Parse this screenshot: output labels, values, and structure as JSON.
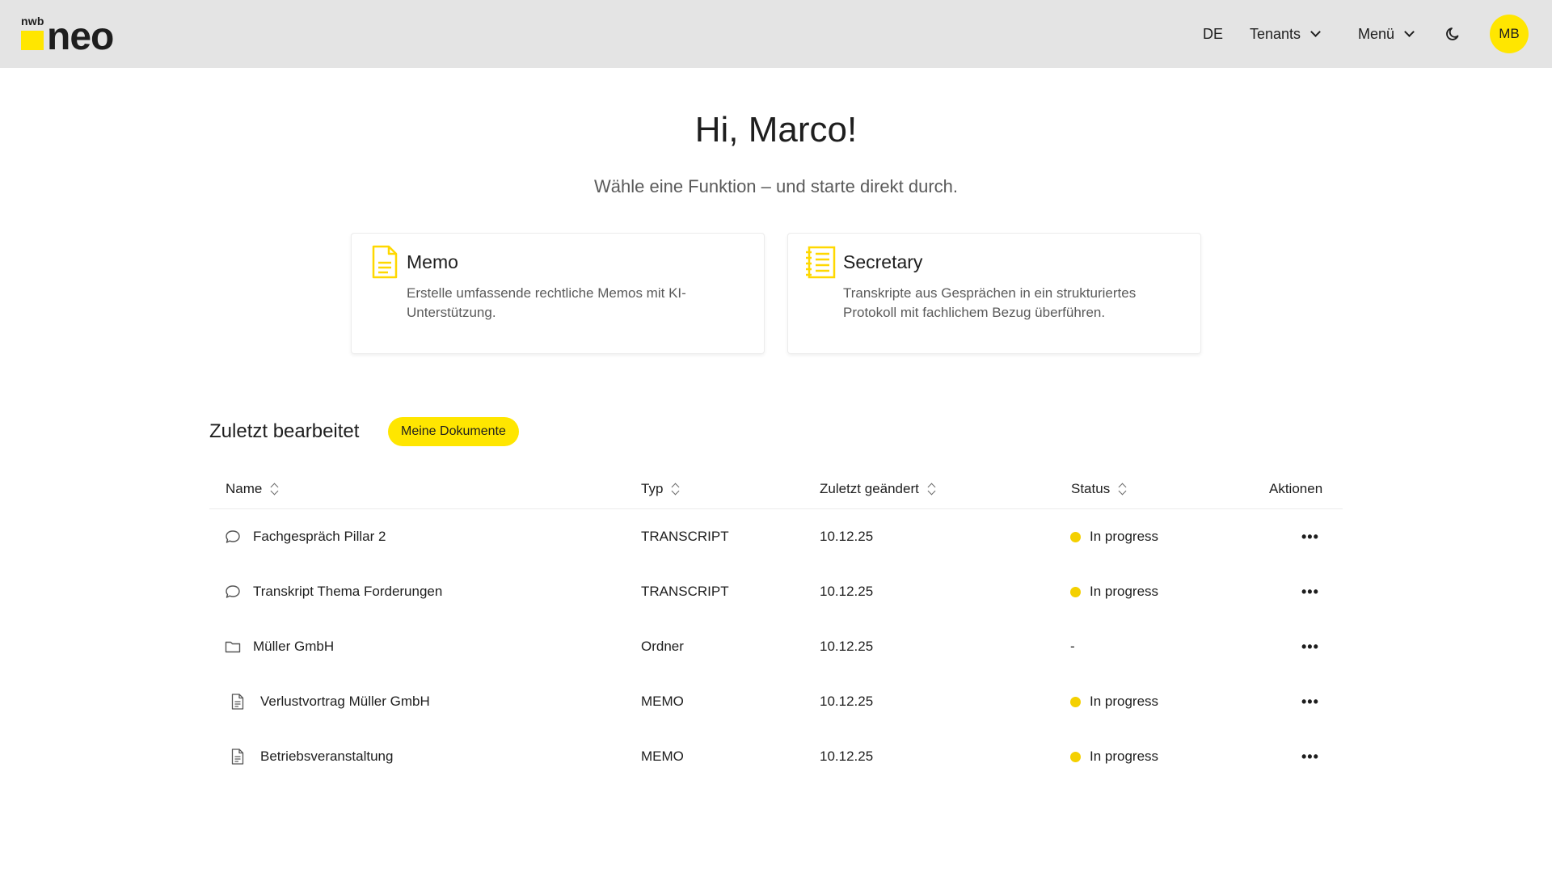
{
  "header": {
    "logo_small": "nwb",
    "logo_main": "neo",
    "language": "DE",
    "tenants_label": "Tenants",
    "menu_label": "Menü",
    "avatar_initials": "MB",
    "accent_color": "#ffe600"
  },
  "welcome": {
    "greeting": "Hi, Marco!",
    "subtitle": "Wähle eine Funktion – und starte direkt durch."
  },
  "cards": [
    {
      "title": "Memo",
      "description": "Erstelle umfassende rechtliche Memos mit KI-Unterstützung.",
      "icon": "document-icon"
    },
    {
      "title": "Secretary",
      "description": "Transkripte aus Gesprächen in ein strukturiertes Protokoll mit fachlichem Bezug überführen.",
      "icon": "notepad-icon"
    }
  ],
  "recent": {
    "title": "Zuletzt bearbeitet",
    "my_documents_label": "Meine Dokumente",
    "columns": {
      "name": "Name",
      "type": "Typ",
      "modified": "Zuletzt geändert",
      "status": "Status",
      "actions": "Aktionen"
    },
    "rows": [
      {
        "icon": "chat-icon",
        "name": "Fachgespräch Pillar 2",
        "type": "TRANSCRIPT",
        "modified": "10.12.25",
        "status": "In progress",
        "actions": "•••"
      },
      {
        "icon": "chat-icon",
        "name": "Transkript Thema Forderungen",
        "type": "TRANSCRIPT",
        "modified": "10.12.25",
        "status": "In progress",
        "actions": "•••"
      },
      {
        "icon": "folder-icon",
        "name": "Müller GmbH",
        "type": "Ordner",
        "modified": "10.12.25",
        "status": "-",
        "actions": "•••"
      },
      {
        "icon": "file-icon",
        "name": "Verlustvortrag Müller GmbH",
        "type": "MEMO",
        "modified": "10.12.25",
        "status": "In progress",
        "actions": "•••"
      },
      {
        "icon": "file-icon",
        "name": "Betriebsveranstaltung",
        "type": "MEMO",
        "modified": "10.12.25",
        "status": "In progress",
        "actions": "•••"
      }
    ],
    "status_color": "#f4d000"
  }
}
